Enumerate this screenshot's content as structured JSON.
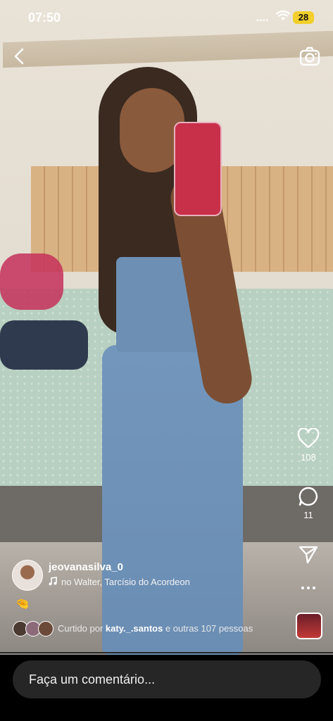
{
  "status_bar": {
    "time": "07:50",
    "battery": "28"
  },
  "nav": {
    "back_icon": "chevron-left-icon",
    "camera_icon": "camera-icon"
  },
  "actions": {
    "likes_count": "108",
    "comments_count": "11",
    "share_icon": "send-icon",
    "more_icon": "more-dots-icon"
  },
  "post": {
    "username": "jeovanasilva_0",
    "music": "no Walter, Tarcísio do Acordeon",
    "emoji": "🤏",
    "liked_by_prefix": "Curtido por ",
    "liked_by_user": "katy._.santos",
    "liked_by_suffix": " e outras 107 pessoas"
  },
  "comment": {
    "placeholder": "Faça um comentário..."
  }
}
